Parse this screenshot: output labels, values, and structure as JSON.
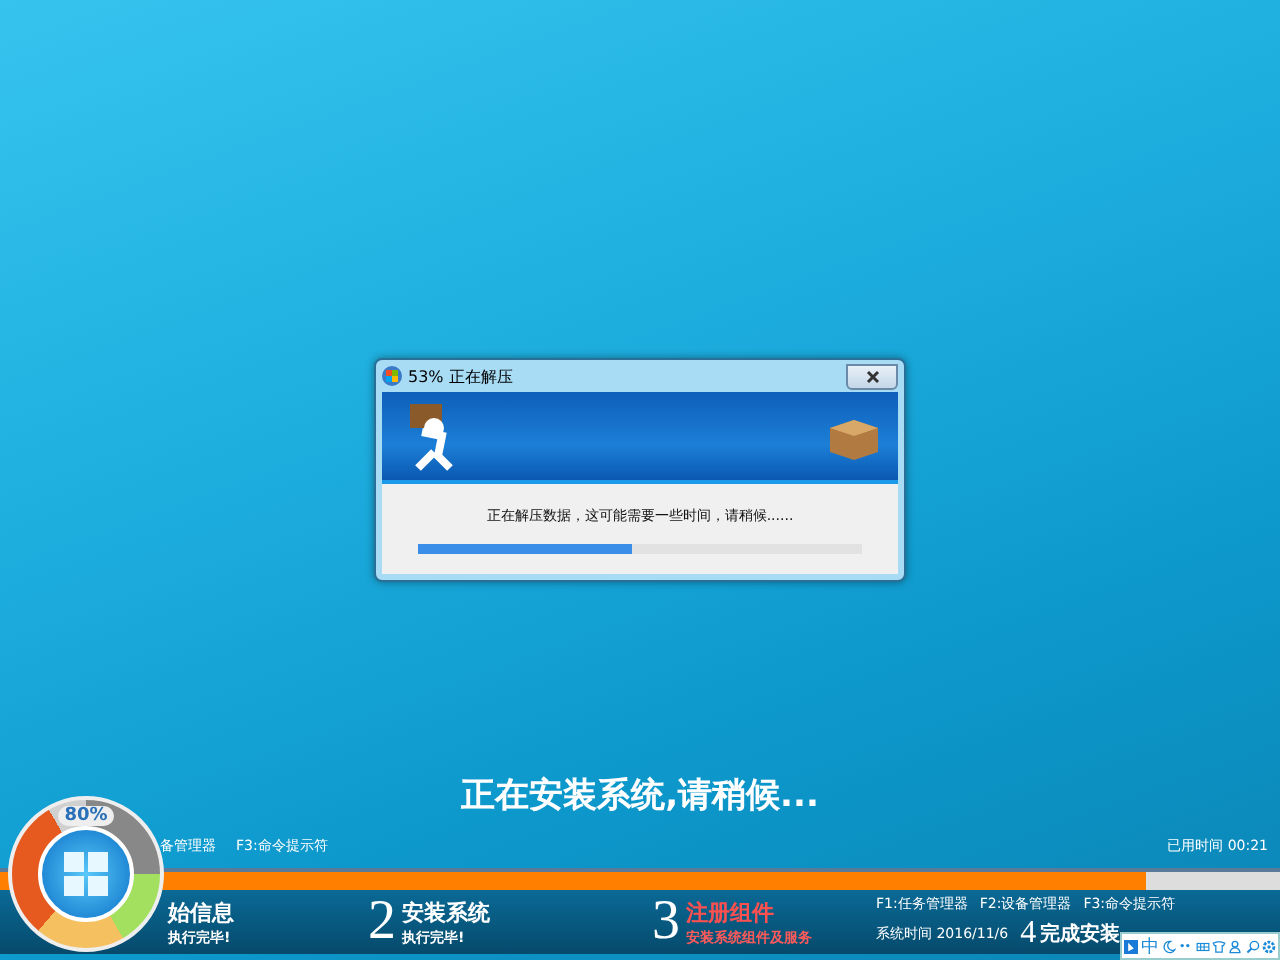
{
  "dialog": {
    "title": "53% 正在解压",
    "message": "正在解压数据，这可能需要一些时间，请稍候......",
    "progress": {
      "level": 0.48
    }
  },
  "install": {
    "headline": "正在安装系统,请稍候...",
    "hotkeys_left": [
      "备管理器",
      "F3:命令提示符"
    ],
    "elapsed": "已用时间 00:21",
    "progress": {
      "level": 0.895
    },
    "badge": "80%",
    "steps": [
      {
        "title": "始信息",
        "subtitle": "执行完毕!",
        "selected": false
      },
      {
        "number": "2",
        "title": "安装系统",
        "subtitle": "执行完毕!",
        "selected": false
      },
      {
        "number": "3",
        "title": "注册组件",
        "subtitle": "安装系统组件及服务",
        "selected": true
      }
    ],
    "hotkeys_right": [
      "F1:任务管理器",
      "F2:设备管理器",
      "F3:命令提示符"
    ],
    "system_time": "系统时间 2016/11/6",
    "final_step": {
      "number": "4",
      "title": "完成安装"
    },
    "ime": {
      "mode": "中"
    }
  }
}
